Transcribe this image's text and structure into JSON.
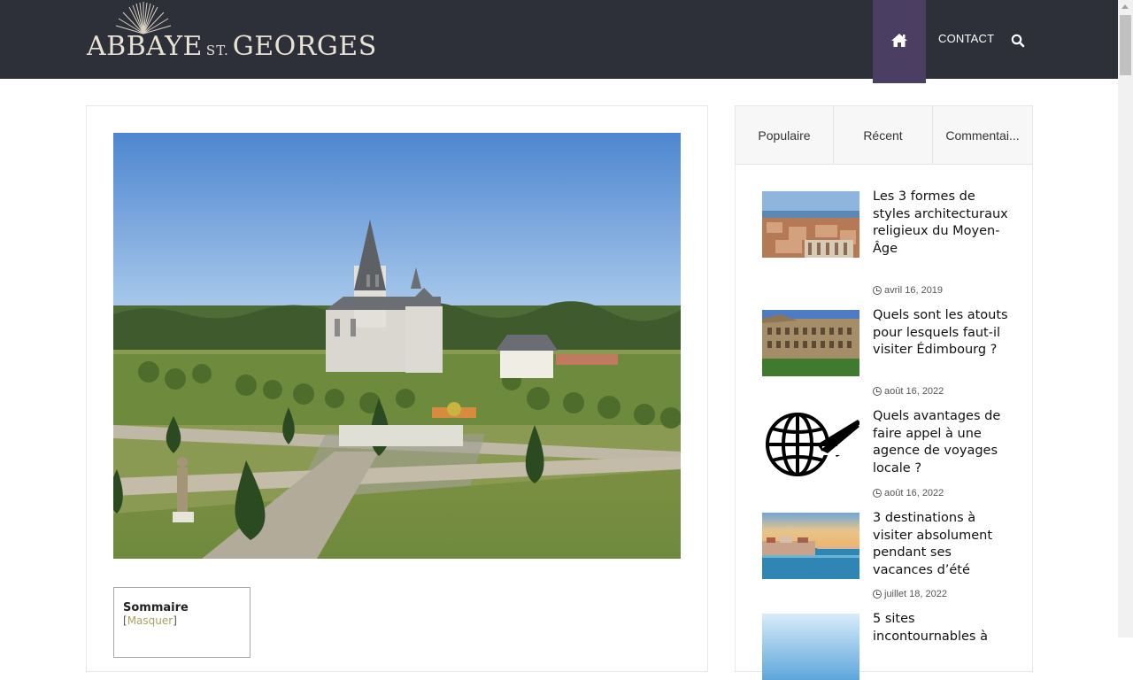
{
  "header": {
    "logo_main_1": "ABBAYE",
    "logo_st": "ST.",
    "logo_main_2": "GEORGES",
    "nav_contact": "CONTACT",
    "home_icon": "home-icon",
    "search_icon": "search-icon"
  },
  "colors": {
    "header_bg": "#2e3039",
    "home_active": "#4a3f63",
    "toc_link": "#a7a260"
  },
  "toc": {
    "title": "Sommaire",
    "bracket_open": "[",
    "toggle": "Masquer",
    "bracket_close": "]"
  },
  "sidebar": {
    "tabs": [
      {
        "label": "Populaire"
      },
      {
        "label": "Récent"
      },
      {
        "label": "Commentai..."
      }
    ],
    "posts": [
      {
        "title": "Les 3 formes de styles architecturaux religieux du Moyen-Âge",
        "date": "avril 16, 2019"
      },
      {
        "title": "Quels sont les atouts pour lesquels faut-il visiter Édimbourg ?",
        "date": "août 16, 2022"
      },
      {
        "title": "Quels avantages de faire appel à une agence de voyages locale ?",
        "date": "août 16, 2022"
      },
      {
        "title": "3 destinations à visiter absolument pendant ses vacances d’été",
        "date": "juillet 18, 2022"
      },
      {
        "title": "5 sites incontournables à",
        "date": ""
      }
    ]
  }
}
